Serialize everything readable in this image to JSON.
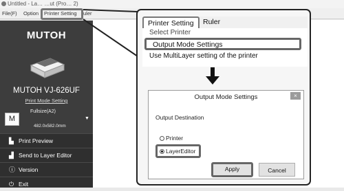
{
  "window": {
    "title": "Untitled - La… …ut (Pro… 2)",
    "menu": [
      "File(F)",
      "Option",
      "Printer Setting",
      "uler"
    ]
  },
  "sidebar": {
    "logo": "MUTOH",
    "model": "MUTOH VJ-626UF",
    "print_mode_link": "Print Mode Setting",
    "media": {
      "letter": "M",
      "name": "Fullsize(A2)",
      "size": "482.0x582.0mm"
    },
    "items": [
      {
        "icon": "print-preview-icon",
        "glyph": "▙",
        "label": "Print Preview"
      },
      {
        "icon": "send-icon",
        "glyph": "▟",
        "label": "Send to Layer Editor"
      },
      {
        "icon": "info-icon",
        "glyph": "ⓘ",
        "label": "Version"
      },
      {
        "icon": "power-icon",
        "glyph": "⏻",
        "label": "Exit"
      }
    ]
  },
  "zoom": {
    "menu": {
      "printer_setting": "Printer Setting",
      "ruler": "Ruler"
    },
    "dropdown": {
      "select_printer": "Select Printer",
      "output_mode": "Output Mode Settings",
      "multilayer": "Use MultiLayer setting of the printer"
    },
    "dialog": {
      "title": "Output Mode Settings",
      "close": "×",
      "group": "Output Destination",
      "options": [
        {
          "label": "Printer",
          "selected": false
        },
        {
          "label": "LayerEditor",
          "selected": true
        }
      ],
      "apply": "Apply",
      "cancel": "Cancel"
    }
  }
}
